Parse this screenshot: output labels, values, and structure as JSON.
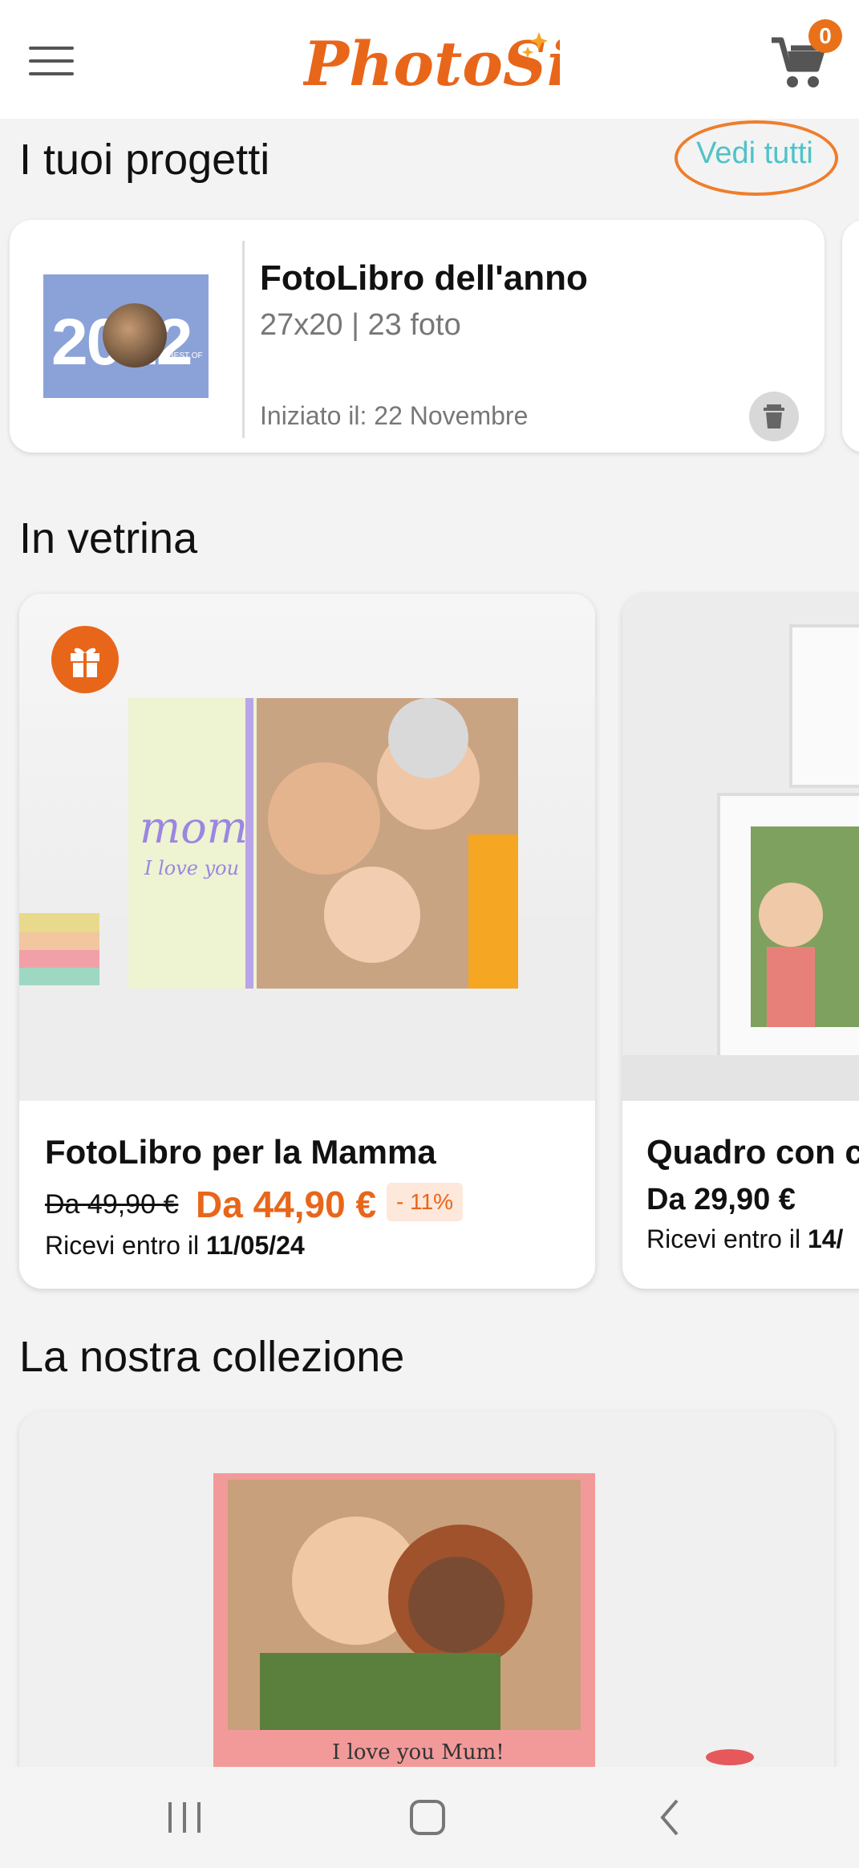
{
  "header": {
    "logo_text": "PhotoSi",
    "cart_count": "0"
  },
  "projects": {
    "title": "I tuoi progetti",
    "view_all": "Vedi tutti",
    "card": {
      "thumb_text": "2022",
      "thumb_caption": "BEST OF",
      "title": "FotoLibro dell'anno",
      "subtitle": "27x20 | 23 foto",
      "started": "Iniziato il: 22 Novembre"
    }
  },
  "showcase": {
    "title": "In vetrina",
    "cards": [
      {
        "name": "FotoLibro per la Mamma",
        "old_price": "Da 49,90 €",
        "new_price": "Da 44,90 €",
        "discount": "- 11%",
        "ship_prefix": "Ricevi entro il ",
        "ship_date": "11/05/24",
        "cover_text": "mom",
        "cover_sub": "I love you"
      },
      {
        "name": "Quadro con c",
        "price": "Da 29,90 €",
        "ship_prefix": "Ricevi entro il ",
        "ship_date": "14/"
      }
    ]
  },
  "collection": {
    "title": "La nostra collezione",
    "book_text": "I love you Mum!"
  },
  "colors": {
    "brand_orange": "#e8661a",
    "link_teal": "#4fc3c7",
    "highlight_ring": "#ef7d2b"
  }
}
